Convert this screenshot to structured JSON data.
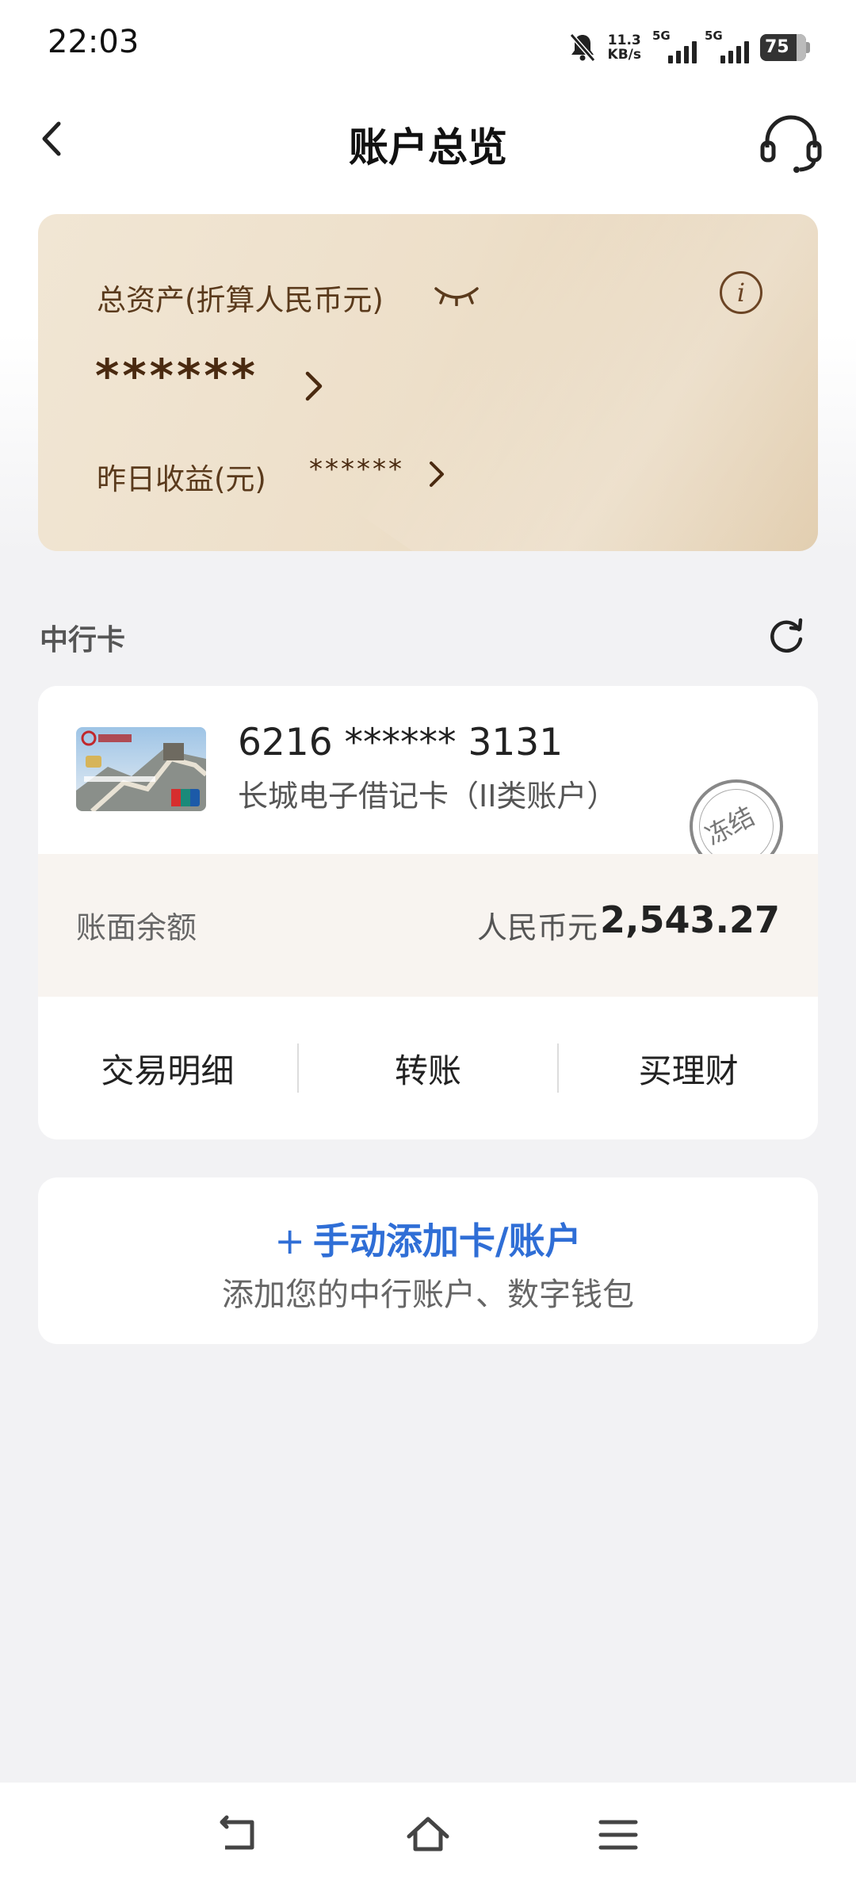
{
  "status_bar": {
    "time": "22:03",
    "speed_value": "11.3",
    "speed_unit": "KB/s",
    "network_1": "5G",
    "network_2": "5G",
    "battery": "75"
  },
  "header": {
    "title": "账户总览"
  },
  "assets": {
    "total_label": "总资产(折算人民币元)",
    "total_value": "******",
    "info_glyph": "i",
    "yesterday_label": "昨日收益(元)",
    "yesterday_value": "******"
  },
  "section": {
    "title": "中行卡"
  },
  "card": {
    "number": "6216 ****** 3131",
    "type": "长城电子借记卡（II类账户）",
    "stamp": "冻结",
    "balance_label": "账面余额",
    "currency": "人民币元",
    "balance": "2,543.27",
    "actions": [
      "交易明细",
      "转账",
      "买理财"
    ]
  },
  "add_card": {
    "plus": "+",
    "title": "手动添加卡/账户",
    "subtitle": "添加您的中行账户、数字钱包"
  },
  "colors": {
    "accent_blue": "#2f6ed6",
    "gold_text": "#4a2a10"
  }
}
